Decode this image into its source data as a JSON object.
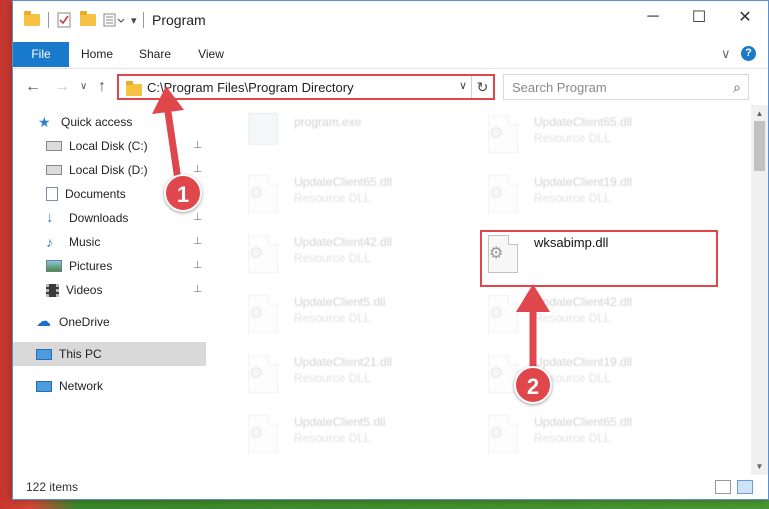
{
  "window": {
    "title": "Program",
    "minimize_label": "─",
    "maximize_label": "☐",
    "close_label": "✕"
  },
  "ribbon": {
    "tabs": [
      {
        "label": "File"
      },
      {
        "label": "Home"
      },
      {
        "label": "Share"
      },
      {
        "label": "View"
      }
    ],
    "expand_glyph": "∨",
    "help_glyph": "?"
  },
  "navigation": {
    "back_glyph": "←",
    "forward_glyph": "→",
    "recent_glyph": "∨",
    "up_glyph": "↑",
    "address": "C:\\Program Files\\Program Directory",
    "address_drop_glyph": "∨",
    "refresh_glyph": "↻",
    "search_placeholder": "Search Program",
    "search_glyph": "⌕"
  },
  "sidebar": {
    "items": [
      {
        "label": "Quick access",
        "icon": "star-icon",
        "pinned": false
      },
      {
        "label": "Local Disk (C:)",
        "icon": "drive-icon",
        "pinned": true
      },
      {
        "label": "Local Disk (D:)",
        "icon": "drive-icon",
        "pinned": true
      },
      {
        "label": "Documents",
        "icon": "documents-icon",
        "pinned": true
      },
      {
        "label": "Downloads",
        "icon": "downloads-icon",
        "pinned": true
      },
      {
        "label": "Music",
        "icon": "music-icon",
        "pinned": true
      },
      {
        "label": "Pictures",
        "icon": "pictures-icon",
        "pinned": true
      },
      {
        "label": "Videos",
        "icon": "videos-icon",
        "pinned": true
      },
      {
        "label": "OneDrive",
        "icon": "cloud-icon",
        "pinned": false
      },
      {
        "label": "This PC",
        "icon": "computer-icon",
        "pinned": false,
        "selected": true
      },
      {
        "label": "Network",
        "icon": "network-icon",
        "pinned": false
      }
    ],
    "pin_glyph": "📌"
  },
  "files": [
    {
      "name": "program.exe",
      "type": ""
    },
    {
      "name": "UpdateClient65.dll",
      "type": "Resource DLL"
    },
    {
      "name": "UpdateClient65.dll",
      "type": "Resource DLL"
    },
    {
      "name": "UpdateClient19.dll",
      "type": "Resource DLL"
    },
    {
      "name": "UpdateClient42.dll",
      "type": "Resource DLL"
    },
    {
      "name": "wksabimp.dll",
      "type": ""
    },
    {
      "name": "UpdateClient5.dll",
      "type": "Resource DLL"
    },
    {
      "name": "UpdateClient42.dll",
      "type": "Resource DLL"
    },
    {
      "name": "UpdateClient21.dll",
      "type": "Resource DLL"
    },
    {
      "name": "UpdateClient19.dll",
      "type": "Resource DLL"
    },
    {
      "name": "UpdateClient5.dll",
      "type": "Resource DLL"
    },
    {
      "name": "UpdateClient65.dll",
      "type": "Resource DLL"
    }
  ],
  "gear_glyph": "⚙",
  "status": {
    "item_count": "122 items"
  },
  "scroll": {
    "up_glyph": "▲",
    "down_glyph": "▼"
  },
  "callouts": [
    "1",
    "2"
  ],
  "colors": {
    "accent": "#1979ca",
    "highlight": "#e0474d"
  }
}
